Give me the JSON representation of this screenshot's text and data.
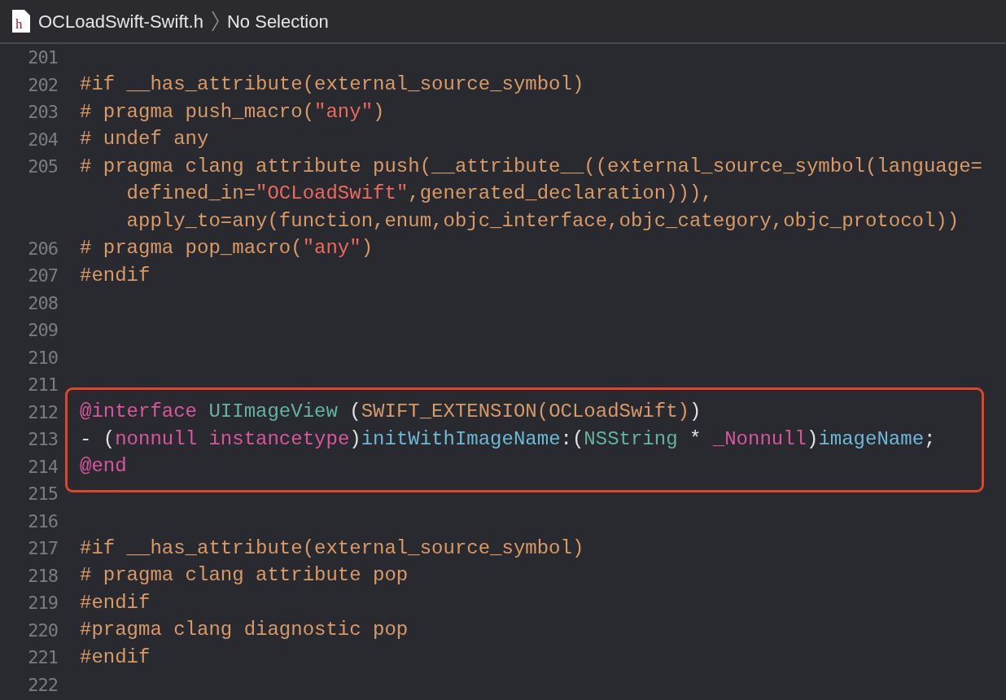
{
  "header": {
    "icon_letter": "h",
    "file_name": "OCLoadSwift-Swift.h",
    "selection": "No Selection"
  },
  "blocks": [
    {
      "highlighted": false,
      "lines": [
        {
          "number": "201"
        },
        {
          "number": "202",
          "rows": [
            [
              {
                "kind": "macro",
                "text": "#if __has_attribute(external_source_symbol)"
              }
            ]
          ]
        },
        {
          "number": "203",
          "rows": [
            [
              {
                "kind": "macro",
                "text": "# pragma push_macro("
              },
              {
                "kind": "string",
                "text": "\"any\""
              },
              {
                "kind": "macro",
                "text": ")"
              }
            ]
          ]
        },
        {
          "number": "204",
          "rows": [
            [
              {
                "kind": "macro",
                "text": "# undef any"
              }
            ]
          ]
        },
        {
          "number": "205",
          "rows": [
            [
              {
                "kind": "macro",
                "text": "# pragma clang attribute push(__attribute__((external_source_symbol(language="
              }
            ],
            [
              {
                "kind": "macro",
                "text": "    defined_in="
              },
              {
                "kind": "string",
                "text": "\"OCLoadSwift\""
              },
              {
                "kind": "macro",
                "text": ",generated_declaration))),"
              }
            ],
            [
              {
                "kind": "macro",
                "text": "    apply_to=any(function,enum,objc_interface,objc_category,objc_protocol))"
              }
            ]
          ]
        },
        {
          "number": "206",
          "rows": [
            [
              {
                "kind": "macro",
                "text": "# pragma pop_macro("
              },
              {
                "kind": "string",
                "text": "\"any\""
              },
              {
                "kind": "macro",
                "text": ")"
              }
            ]
          ]
        },
        {
          "number": "207",
          "rows": [
            [
              {
                "kind": "macro",
                "text": "#endif"
              }
            ]
          ]
        },
        {
          "number": "208"
        },
        {
          "number": "209"
        },
        {
          "number": "210"
        },
        {
          "number": "211"
        }
      ]
    },
    {
      "highlighted": true,
      "lines": [
        {
          "number": "212",
          "rows": [
            [
              {
                "kind": "keyword",
                "text": "@interface"
              },
              {
                "kind": "plain",
                "text": " "
              },
              {
                "kind": "type",
                "text": "UIImageView"
              },
              {
                "kind": "plain",
                "text": " ("
              },
              {
                "kind": "macro",
                "text": "SWIFT_EXTENSION(OCLoadSwift)"
              },
              {
                "kind": "plain",
                "text": ")"
              }
            ]
          ]
        },
        {
          "number": "213",
          "rows": [
            [
              {
                "kind": "plain",
                "text": "- ("
              },
              {
                "kind": "keyword",
                "text": "nonnull"
              },
              {
                "kind": "plain",
                "text": " "
              },
              {
                "kind": "keyword",
                "text": "instancetype"
              },
              {
                "kind": "plain",
                "text": ")"
              },
              {
                "kind": "method",
                "text": "initWithImageName"
              },
              {
                "kind": "plain",
                "text": ":("
              },
              {
                "kind": "type",
                "text": "NSString"
              },
              {
                "kind": "plain",
                "text": " * "
              },
              {
                "kind": "keyword",
                "text": "_Nonnull"
              },
              {
                "kind": "plain",
                "text": ")"
              },
              {
                "kind": "method",
                "text": "imageName"
              },
              {
                "kind": "plain",
                "text": ";"
              }
            ]
          ]
        },
        {
          "number": "214",
          "rows": [
            [
              {
                "kind": "keyword",
                "text": "@end"
              }
            ]
          ]
        }
      ]
    },
    {
      "highlighted": false,
      "lines": [
        {
          "number": "215"
        },
        {
          "number": "216"
        },
        {
          "number": "217",
          "rows": [
            [
              {
                "kind": "macro",
                "text": "#if __has_attribute(external_source_symbol)"
              }
            ]
          ]
        },
        {
          "number": "218",
          "rows": [
            [
              {
                "kind": "macro",
                "text": "# pragma clang attribute pop"
              }
            ]
          ]
        },
        {
          "number": "219",
          "rows": [
            [
              {
                "kind": "macro",
                "text": "#endif"
              }
            ]
          ]
        },
        {
          "number": "220",
          "rows": [
            [
              {
                "kind": "macro",
                "text": "#pragma clang diagnostic pop"
              }
            ]
          ]
        },
        {
          "number": "221",
          "rows": [
            [
              {
                "kind": "macro",
                "text": "#endif"
              }
            ]
          ]
        },
        {
          "number": "222"
        }
      ]
    }
  ]
}
